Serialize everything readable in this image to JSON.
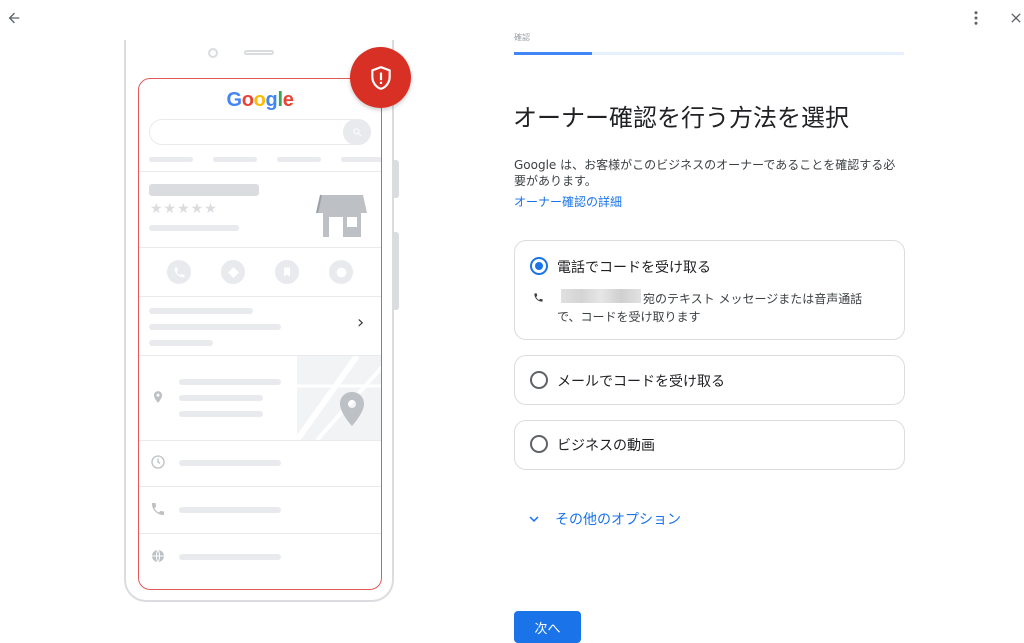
{
  "topbar": {
    "back_icon": "arrow-back-icon",
    "more_icon": "more-vert-icon",
    "close_icon": "close-icon"
  },
  "illustration": {
    "logo_letters": [
      "G",
      "o",
      "o",
      "g",
      "l",
      "e"
    ],
    "stars": "★★★★★",
    "chevron": "›",
    "badge_icon": "shield-alert-icon"
  },
  "progress": {
    "label": "確認",
    "value_fraction": 0.2
  },
  "title": "オーナー確認を行う方法を選択",
  "description": "Google は、お客様がこのビジネスのオーナーであることを確認する必要があります。",
  "learn_more": "オーナー確認の詳細",
  "options": [
    {
      "label": "電話でコードを受け取る",
      "selected": true,
      "detail_line1": "宛のテキスト メッセージまたは音声通話",
      "detail_line2": "で、コードを受け取ります"
    },
    {
      "label": "メールでコードを受け取る",
      "selected": false
    },
    {
      "label": "ビジネスの動画",
      "selected": false
    }
  ],
  "more_options": "その他のオプション",
  "next_button": "次へ",
  "colors": {
    "accent": "#1a73e8",
    "badge": "#d93025",
    "phone_outline": "#e35a5a"
  }
}
